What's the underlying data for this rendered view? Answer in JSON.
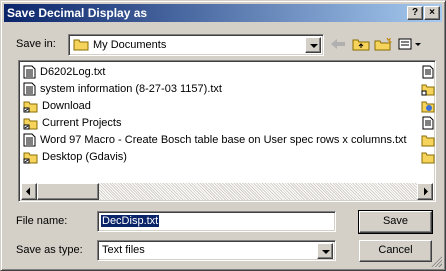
{
  "window": {
    "title": "Save Decimal Display as"
  },
  "titlebar_buttons": {
    "help": "?",
    "close": "×"
  },
  "save_in": {
    "label": "Save in:",
    "value": "My Documents"
  },
  "file_list": {
    "items": [
      {
        "name": "D6202Log.txt",
        "type": "text-file-icon"
      },
      {
        "name": "system information (8-27-03 1157).txt",
        "type": "text-file-icon"
      },
      {
        "name": "Download",
        "type": "folder-shortcut-icon"
      },
      {
        "name": "Current Projects",
        "type": "folder-shortcut-icon"
      },
      {
        "name": "Word 97 Macro - Create Bosch table base on User spec rows x columns.txt",
        "type": "text-file-icon"
      },
      {
        "name": "Desktop (Gdavis)",
        "type": "folder-shortcut-icon"
      }
    ]
  },
  "file_name": {
    "label": "File name:",
    "value": "DecDisp.txt"
  },
  "save_as_type": {
    "label": "Save as type:",
    "value": "Text files"
  },
  "buttons": {
    "save": "Save",
    "cancel": "Cancel"
  }
}
